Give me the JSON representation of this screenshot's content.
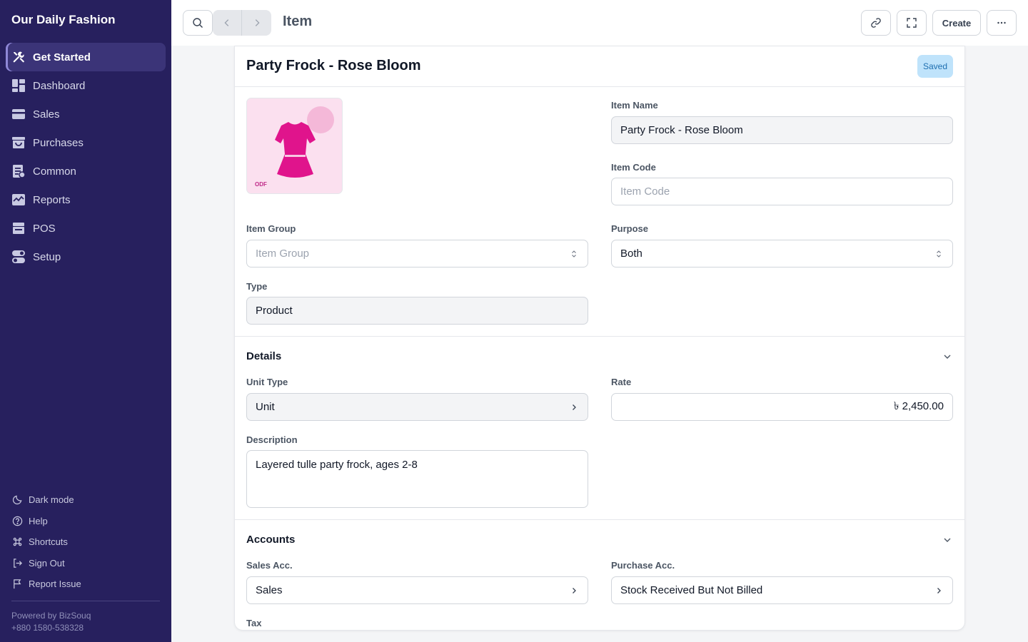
{
  "app": {
    "brand": "Our Daily Fashion",
    "powered_by": "Powered by BizSouq",
    "phone": "+880 1580-538328"
  },
  "sidebar": {
    "items": [
      {
        "label": "Get Started",
        "icon": "tools-icon",
        "active": true
      },
      {
        "label": "Dashboard",
        "icon": "dashboard-icon",
        "active": false
      },
      {
        "label": "Sales",
        "icon": "sales-icon",
        "active": false
      },
      {
        "label": "Purchases",
        "icon": "purchases-icon",
        "active": false
      },
      {
        "label": "Common",
        "icon": "common-icon",
        "active": false
      },
      {
        "label": "Reports",
        "icon": "reports-icon",
        "active": false
      },
      {
        "label": "POS",
        "icon": "pos-icon",
        "active": false
      },
      {
        "label": "Setup",
        "icon": "setup-icon",
        "active": false
      }
    ],
    "bottom": [
      {
        "label": "Dark mode",
        "icon": "moon-icon"
      },
      {
        "label": "Help",
        "icon": "help-icon"
      },
      {
        "label": "Shortcuts",
        "icon": "command-icon"
      },
      {
        "label": "Sign Out",
        "icon": "sign-out-icon"
      },
      {
        "label": "Report Issue",
        "icon": "flag-icon"
      }
    ]
  },
  "topbar": {
    "title": "Item",
    "create_label": "Create"
  },
  "doc": {
    "title": "Party Frock - Rose Bloom",
    "status": "Saved",
    "image_brand": "ODF",
    "item_name_label": "Item Name",
    "item_name": "Party Frock - Rose Bloom",
    "item_code_label": "Item Code",
    "item_code_placeholder": "Item Code",
    "item_group_label": "Item Group",
    "item_group_placeholder": "Item Group",
    "purpose_label": "Purpose",
    "purpose": "Both",
    "type_label": "Type",
    "type": "Product"
  },
  "details": {
    "title": "Details",
    "unit_type_label": "Unit Type",
    "unit_type": "Unit",
    "rate_label": "Rate",
    "rate": "৳ 2,450.00",
    "description_label": "Description",
    "description": "Layered tulle party frock, ages 2-8"
  },
  "accounts": {
    "title": "Accounts",
    "sales_acc_label": "Sales Acc.",
    "sales_acc": "Sales",
    "purchase_acc_label": "Purchase Acc.",
    "purchase_acc": "Stock Received But Not Billed",
    "tax_label": "Tax"
  },
  "colors": {
    "sidebar_bg": "#27205e",
    "saved_badge_bg": "#bfe3fb",
    "frock_pink": "#e0148c"
  }
}
